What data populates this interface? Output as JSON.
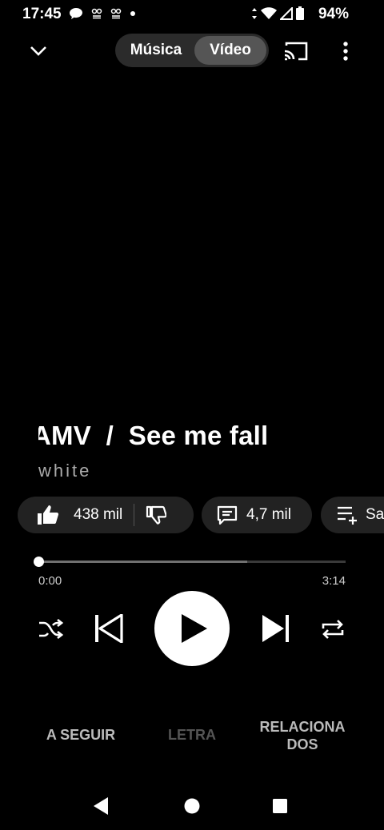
{
  "status_bar": {
    "time": "17:45",
    "battery": "94%",
    "notification_icons": [
      "chat-bubble-icon",
      "app-icon",
      "app-icon",
      "dot-icon"
    ],
    "system_icons": [
      "data-arrows-icon",
      "wifi-icon",
      "signal-icon",
      "battery-icon"
    ]
  },
  "top_bar": {
    "mode_music": "Música",
    "mode_video": "Vídeo",
    "selected_mode": "Vídeo"
  },
  "track": {
    "title": "AMV  /  See me fall",
    "artist": "white"
  },
  "actions": {
    "likes": "438 mil",
    "comments": "4,7 mil",
    "save": "Salvar"
  },
  "playback": {
    "current_time": "0:00",
    "total_time": "3:14",
    "progress_fraction": 0,
    "buffered_fraction": 0.68,
    "state": "paused"
  },
  "tabs": {
    "up_next": "A SEGUIR",
    "lyrics": "LETRA",
    "related": "RELACIONA DOS"
  },
  "colors": {
    "background": "#000000",
    "pill": "#222222",
    "toggle_selected": "#555555",
    "disabled_text": "#555555"
  }
}
